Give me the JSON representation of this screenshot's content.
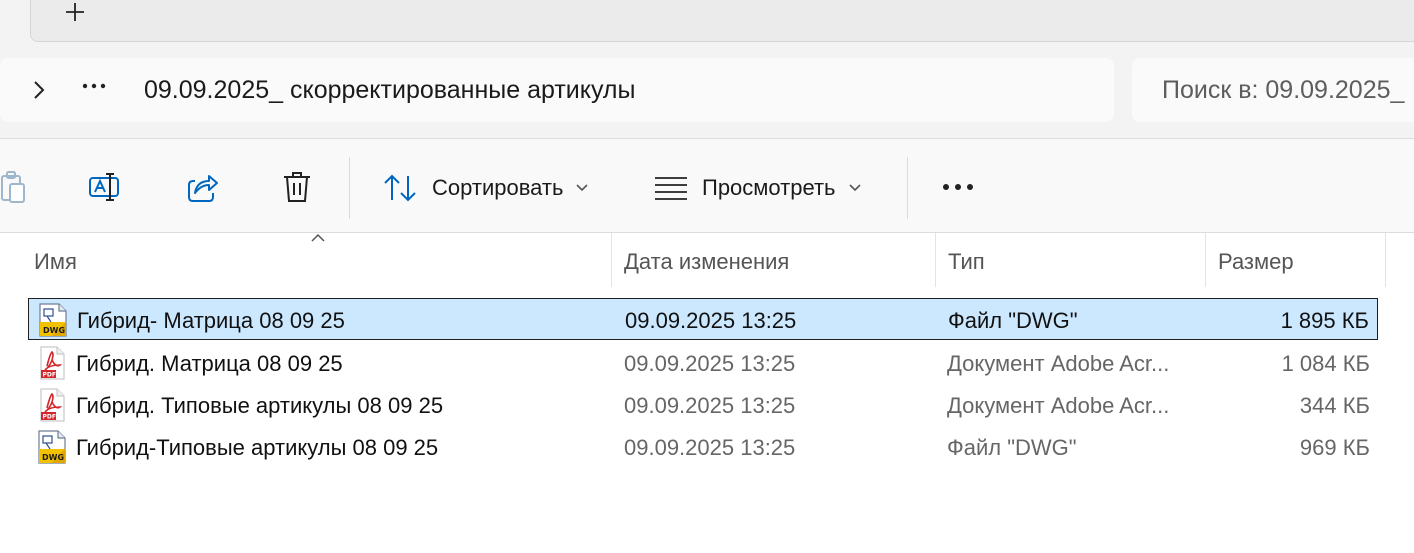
{
  "address_bar": {
    "path": "09.09.2025_ скорректированные артикулы",
    "search_placeholder": "Поиск в: 09.09.2025_"
  },
  "commands": {
    "sort_label": "Сортировать",
    "view_label": "Просмотреть"
  },
  "columns": {
    "name": "Имя",
    "date": "Дата изменения",
    "type": "Тип",
    "size": "Размер"
  },
  "files": [
    {
      "name": "Гибрид- Матрица 08 09 25",
      "date": "09.09.2025 13:25",
      "type": "Файл \"DWG\"",
      "size": "1 895 КБ",
      "icon": "dwg-file-icon",
      "selected": true
    },
    {
      "name": "Гибрид. Матрица 08 09 25",
      "date": "09.09.2025 13:25",
      "type": "Документ Adobe Acr...",
      "size": "1 084 КБ",
      "icon": "pdf-file-icon",
      "selected": false
    },
    {
      "name": "Гибрид. Типовые артикулы 08 09 25",
      "date": "09.09.2025 13:25",
      "type": "Документ Adobe Acr...",
      "size": "344 КБ",
      "icon": "pdf-file-icon",
      "selected": false
    },
    {
      "name": "Гибрид-Типовые артикулы 08 09 25",
      "date": "09.09.2025 13:25",
      "type": "Файл \"DWG\"",
      "size": "969 КБ",
      "icon": "dwg-file-icon",
      "selected": false
    }
  ],
  "colors": {
    "selection": "#cce8ff",
    "accent": "#0067c0",
    "pdf_red": "#d4272b",
    "dwg_yellow": "#f2c200"
  }
}
